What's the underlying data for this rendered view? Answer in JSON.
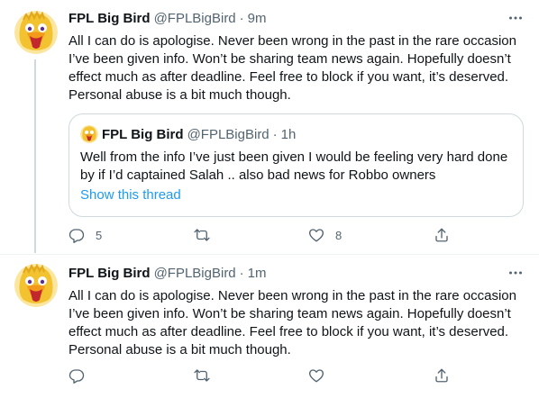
{
  "tweets": [
    {
      "author_name": "FPL Big Bird",
      "handle": "@FPLBigBird",
      "separator": "·",
      "time": "9m",
      "text": "All I can do is apologise. Never been wrong in the past in the rare occasion I’ve been given info. Won’t be sharing team news again. Hopefully doesn’t effect much as after deadline. Feel free to block if you want, it’s deserved. Personal abuse is a bit much though.",
      "quote": {
        "author_name": "FPL Big Bird",
        "handle": "@FPLBigBird",
        "separator": "·",
        "time": "1h",
        "text": "Well from the info I’ve just been given I would be feeling very hard done by if I’d captained Salah .. also bad news for Robbo owners",
        "show_thread": "Show this thread"
      },
      "actions": {
        "replies": "5",
        "retweets": "",
        "likes": "8"
      }
    },
    {
      "author_name": "FPL Big Bird",
      "handle": "@FPLBigBird",
      "separator": "·",
      "time": "1m",
      "text": "All I can do is apologise. Never been wrong in the past in the rare occasion I’ve been given info. Won’t be sharing team news again. Hopefully doesn’t effect much as after deadline. Feel free to block if you want, it’s deserved. Personal abuse is a bit much though.",
      "actions": {
        "replies": "",
        "retweets": "",
        "likes": ""
      }
    }
  ],
  "icons": {
    "avatar": "big-bird-avatar-icon",
    "more": "more-options-icon",
    "reply": "reply-icon",
    "retweet": "retweet-icon",
    "like": "heart-icon",
    "share": "share-icon"
  },
  "colors": {
    "text_primary": "#0f1419",
    "text_secondary": "#536471",
    "link": "#1d9bf0",
    "border": "#cfd9de",
    "avatar_yellow": "#f2c230"
  }
}
